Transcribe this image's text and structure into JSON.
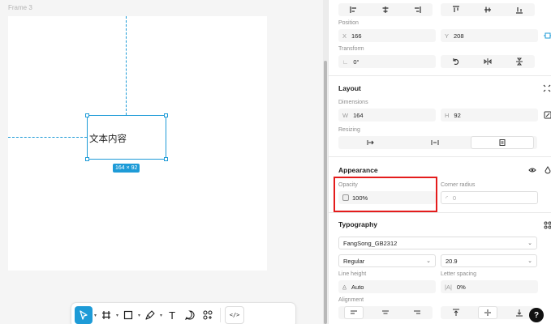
{
  "canvas": {
    "frame_label": "Frame 3",
    "text_content": "文本内容",
    "size_badge": "164 × 92"
  },
  "toolbar": {
    "tools": [
      {
        "name": "move-tool",
        "icon": "cursor-icon",
        "active": true
      },
      {
        "name": "frame-tool",
        "icon": "hash-icon"
      },
      {
        "name": "shape-tool",
        "icon": "rectangle-icon"
      },
      {
        "name": "pen-tool",
        "icon": "pen-icon"
      },
      {
        "name": "text-tool",
        "icon": "text-icon",
        "label": "T"
      },
      {
        "name": "comment-tool",
        "icon": "comment-icon"
      },
      {
        "name": "actions-tool",
        "icon": "actions-icon"
      },
      {
        "name": "dev-mode-toggle",
        "icon": "code-icon",
        "label": "</>"
      }
    ]
  },
  "panel": {
    "position": {
      "label": "Position",
      "x_prefix": "X",
      "x_value": "166",
      "y_prefix": "Y",
      "y_value": "208"
    },
    "transform": {
      "label": "Transform",
      "rotation_value": "0°"
    },
    "layout": {
      "title": "Layout",
      "dimensions_label": "Dimensions",
      "w_prefix": "W",
      "w_value": "164",
      "h_prefix": "H",
      "h_value": "92",
      "resizing_label": "Resizing"
    },
    "appearance": {
      "title": "Appearance",
      "opacity_label": "Opacity",
      "opacity_value": "100%",
      "corner_radius_label": "Corner radius",
      "corner_radius_value": "0"
    },
    "typography": {
      "title": "Typography",
      "font_family": "FangSong_GB2312",
      "font_style": "Regular",
      "font_size": "20.9",
      "line_height_label": "Line height",
      "line_height_value": "Auto",
      "letter_spacing_label": "Letter spacing",
      "letter_spacing_value": "0%",
      "alignment_label": "Alignment"
    },
    "help_label": "?"
  },
  "colors": {
    "accent": "#1e9bd7",
    "highlight": "#e41c1c"
  }
}
